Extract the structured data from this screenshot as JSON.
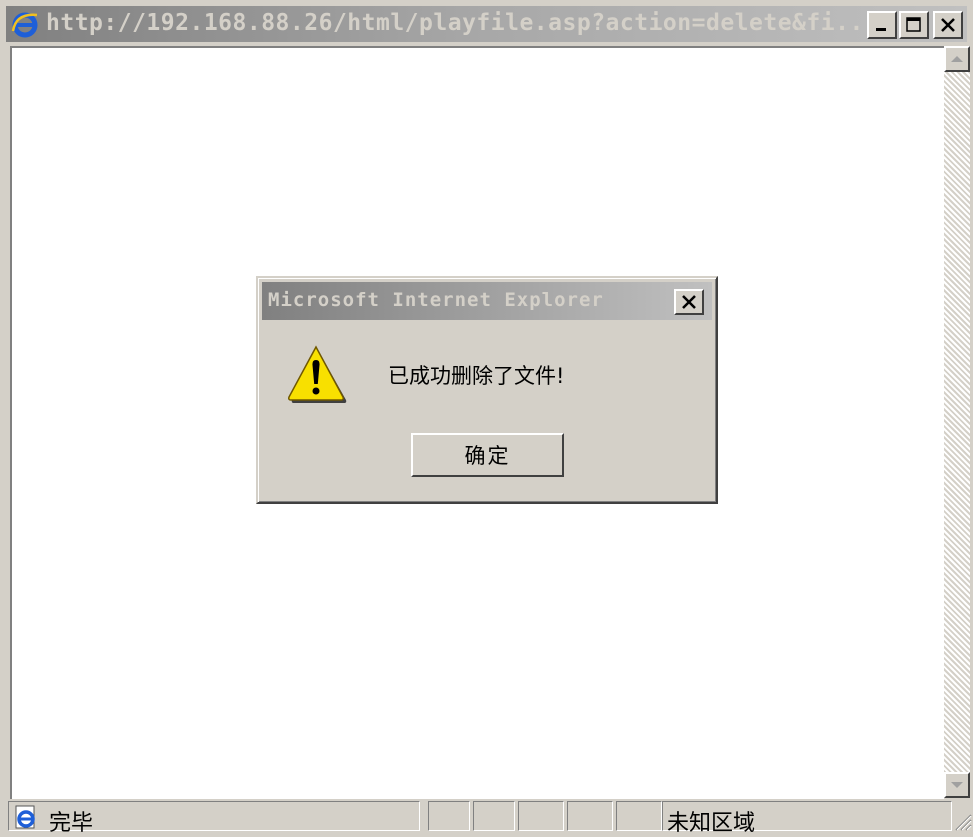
{
  "window": {
    "title": "http://192.168.88.26/html/playfile.asp?action=delete&fi...",
    "title_icon": "ie-icon",
    "buttons": [
      "minimize",
      "maximize",
      "close"
    ]
  },
  "dialog": {
    "title": "Microsoft Internet Explorer",
    "icon": "warning-icon",
    "message": "已成功删除了文件!",
    "ok_label": "确定"
  },
  "statusbar": {
    "status_text": "完毕",
    "zone_text": "未知区域"
  },
  "colors": {
    "window_face": "#d4d0c8",
    "title_inactive_start": "#808080",
    "title_inactive_end": "#c0c0c0",
    "title_text": "#d4d0c8"
  }
}
